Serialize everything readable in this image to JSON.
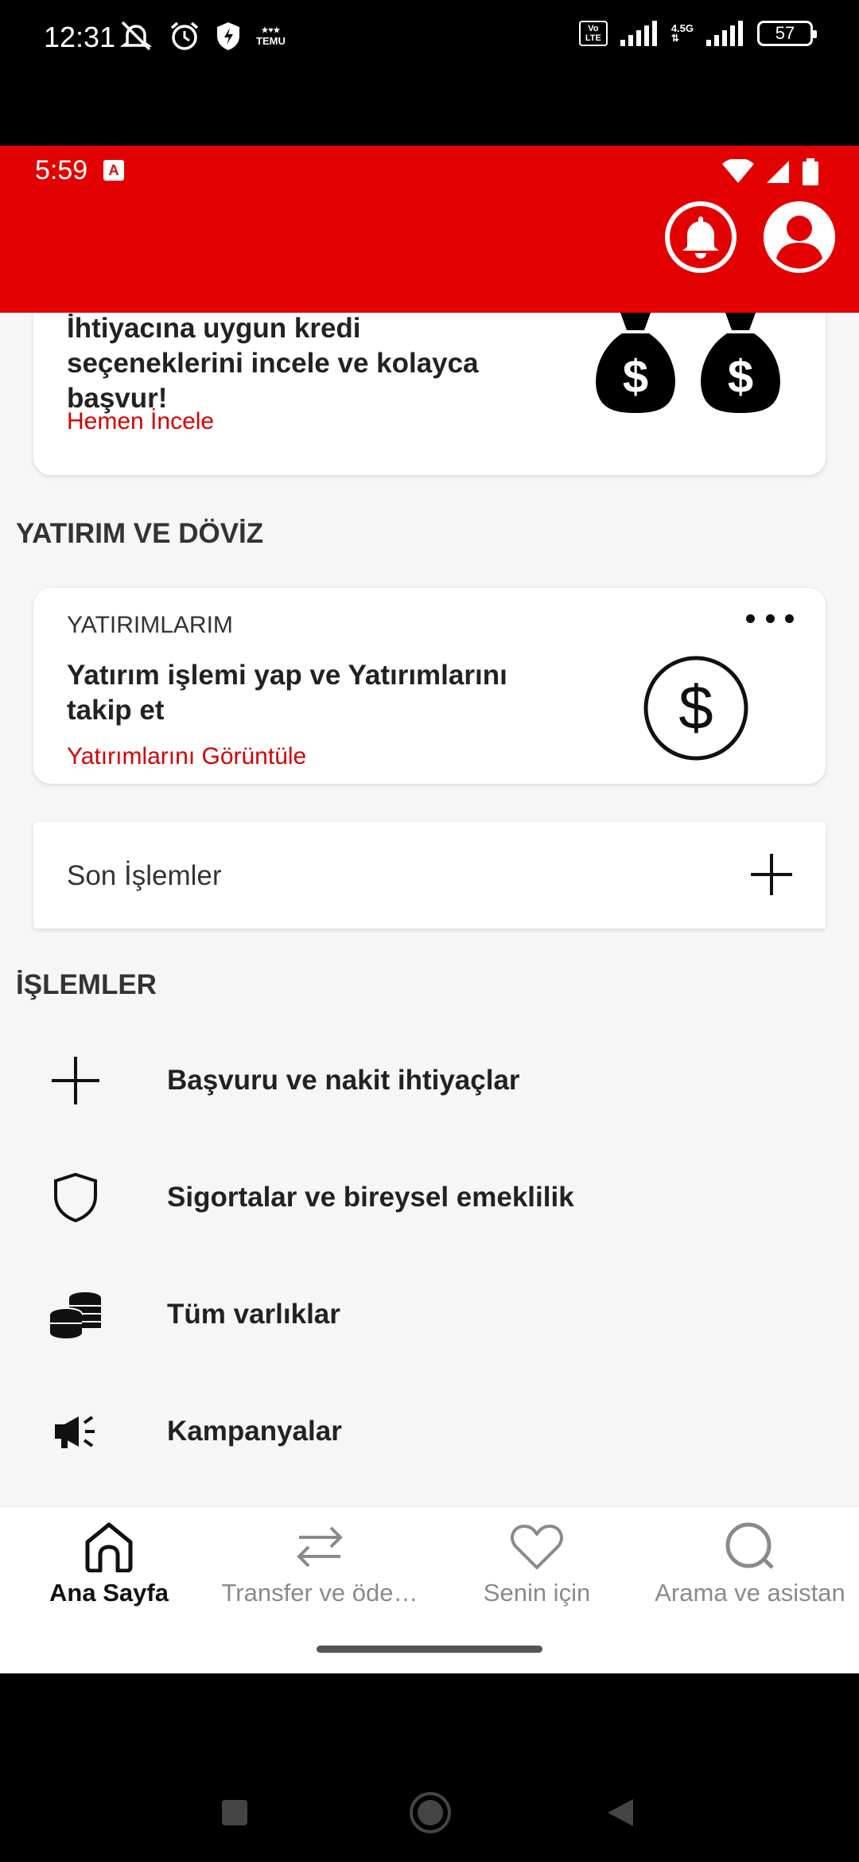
{
  "outer_status": {
    "time": "12:31",
    "temu_label": "TEMU",
    "volte_label": "Vo LTE",
    "network_label": "4.5G",
    "battery": "57"
  },
  "app_status": {
    "time": "5:59",
    "a_icon": "A"
  },
  "header": {
    "bell_icon": "bell-icon",
    "profile_icon": "profile-icon",
    "accent": "#e30000"
  },
  "loan_card": {
    "text": "İhtiyacına uygun kredi seçeneklerini incele ve kolayca başvur!",
    "link": "Hemen İncele"
  },
  "investment_section": {
    "title": "YATIRIM VE DÖVİZ",
    "card_label": "YATIRIMLARIM",
    "card_text": "Yatırım işlemi yap ve Yatırımlarını takip et",
    "card_link": "Yatırımlarını Görüntüle"
  },
  "recent": {
    "label": "Son İşlemler"
  },
  "operations": {
    "title": "İŞLEMLER",
    "items": [
      {
        "label": "Başvuru ve nakit ihtiyaçlar",
        "icon": "plus-icon"
      },
      {
        "label": "Sigortalar ve bireysel emeklilik",
        "icon": "shield-icon"
      },
      {
        "label": "Tüm varlıklar",
        "icon": "coins-icon"
      },
      {
        "label": "Kampanyalar",
        "icon": "megaphone-icon"
      }
    ]
  },
  "bottom_nav": {
    "items": [
      {
        "label": "Ana Sayfa",
        "icon": "home-icon",
        "active": true
      },
      {
        "label": "Transfer ve öde…",
        "icon": "transfer-icon",
        "active": false
      },
      {
        "label": "Senin için",
        "icon": "heart-icon",
        "active": false
      },
      {
        "label": "Arama ve asistan",
        "icon": "search-icon",
        "active": false
      }
    ]
  },
  "colors": {
    "link": "#d40000",
    "text": "#222222"
  }
}
